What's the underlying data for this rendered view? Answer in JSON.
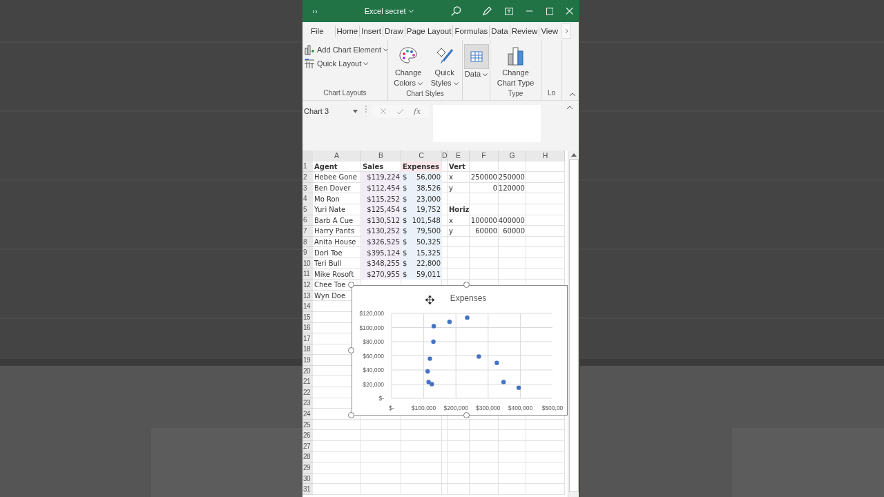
{
  "window": {
    "title": "Excel secret"
  },
  "ribbon": {
    "tabs": [
      {
        "label": "File",
        "selected": false
      },
      {
        "label": "Home",
        "selected": false
      },
      {
        "label": "Insert",
        "selected": false
      },
      {
        "label": "Draw",
        "selected": false
      },
      {
        "label": "Page Layout",
        "selected": false
      },
      {
        "label": "Formulas",
        "selected": false
      },
      {
        "label": "Data",
        "selected": false
      },
      {
        "label": "Review",
        "selected": false
      },
      {
        "label": "View",
        "selected": false
      }
    ],
    "groups": [
      {
        "label": "Chart Layouts",
        "kind": "small",
        "buttons": [
          {
            "label": "Add Chart Element",
            "dropdown": true
          },
          {
            "label": "Quick Layout",
            "dropdown": true
          }
        ]
      },
      {
        "label": "Chart Styles",
        "kind": "large",
        "buttons": [
          {
            "label": "Change Colors",
            "dropdown": true
          },
          {
            "label": "Quick Styles",
            "dropdown": true
          }
        ]
      },
      {
        "kind": "large",
        "buttons": [
          {
            "label": "Data",
            "dropdown": true,
            "highlighted": true
          }
        ]
      },
      {
        "label": "Type",
        "kind": "large",
        "buttons": [
          {
            "label": "Change Chart Type",
            "dropdown": false
          }
        ]
      },
      {
        "label": "Lo",
        "kind": "large"
      }
    ]
  },
  "formula_bar": {
    "name_box": "Chart 3",
    "fx": "fx"
  },
  "sheet": {
    "columns": [
      {
        "label": "A",
        "kind": "text"
      },
      {
        "label": "B",
        "kind": "number"
      },
      {
        "label": "C",
        "kind": "accounting"
      },
      {
        "label": "D"
      },
      {
        "label": "E",
        "kind": "text"
      },
      {
        "label": "F",
        "kind": "number"
      },
      {
        "label": "G",
        "kind": "number"
      },
      {
        "label": "H"
      }
    ],
    "rows": [
      {
        "number": "1",
        "cells": [
          {
            "text": "Agent",
            "bold": true
          },
          {
            "text": "Sales",
            "bold": true,
            "kind": "text"
          },
          {
            "text": "Expenses",
            "bold": true,
            "kind": "text",
            "color": "#fbe6ea"
          },
          "",
          {
            "text": "Vert",
            "bold": true
          }
        ]
      },
      {
        "number": "2",
        "cells": [
          "Hebee Gone",
          {
            "text": "$119,224",
            "color": "#f2ecf7"
          },
          {
            "symbol": "$",
            "text": "56,000",
            "color": "#eaf1f9"
          },
          "",
          "x",
          "250000",
          "250000"
        ]
      },
      {
        "number": "3",
        "cells": [
          "Ben Dover",
          {
            "text": "$112,454",
            "color": "#f2ecf7"
          },
          {
            "symbol": "$",
            "text": "38,526",
            "color": "#eaf1f9"
          },
          "",
          "y",
          "0",
          "120000"
        ]
      },
      {
        "number": "4",
        "cells": [
          "Mo Ron",
          {
            "text": "$115,252",
            "color": "#f2ecf7"
          },
          {
            "symbol": "$",
            "text": "23,000",
            "color": "#eaf1f9"
          }
        ]
      },
      {
        "number": "5",
        "cells": [
          "Yuri Nate",
          {
            "text": "$125,454",
            "color": "#f2ecf7"
          },
          {
            "symbol": "$",
            "text": "19,752",
            "color": "#eaf1f9"
          },
          "",
          {
            "text": "Horiz",
            "bold": true
          }
        ]
      },
      {
        "number": "6",
        "cells": [
          "Barb A Cue",
          {
            "text": "$130,512",
            "color": "#f2ecf7"
          },
          {
            "symbol": "$",
            "text": "101,548",
            "color": "#eaf1f9"
          },
          "",
          "x",
          "100000",
          "400000"
        ]
      },
      {
        "number": "7",
        "cells": [
          "Harry Pants",
          {
            "text": "$130,252",
            "color": "#f2ecf7"
          },
          {
            "symbol": "$",
            "text": "79,500",
            "color": "#eaf1f9"
          },
          "",
          "y",
          "60000",
          "60000"
        ]
      },
      {
        "number": "8",
        "cells": [
          "Anita House",
          {
            "text": "$326,525",
            "color": "#f2ecf7"
          },
          {
            "symbol": "$",
            "text": "50,325",
            "color": "#eaf1f9"
          }
        ]
      },
      {
        "number": "9",
        "cells": [
          "Dori Toe",
          {
            "text": "$395,124",
            "color": "#f2ecf7"
          },
          {
            "symbol": "$",
            "text": "15,325",
            "color": "#eaf1f9"
          }
        ]
      },
      {
        "number": "10",
        "cells": [
          "Teri Bull",
          {
            "text": "$348,255",
            "color": "#f2ecf7"
          },
          {
            "symbol": "$",
            "text": "22,800",
            "color": "#eaf1f9"
          }
        ]
      },
      {
        "number": "11",
        "cells": [
          "Mike Rosoft",
          {
            "text": "$270,955",
            "color": "#f2ecf7"
          },
          {
            "symbol": "$",
            "text": "59,011",
            "color": "#eaf1f9"
          }
        ]
      },
      {
        "number": "12",
        "cells": [
          "Chee Toe"
        ]
      },
      {
        "number": "13",
        "cells": [
          "Wyn Doe"
        ]
      },
      {
        "number": "14",
        "cells": []
      },
      {
        "number": "15",
        "cells": []
      },
      {
        "number": "16",
        "cells": []
      },
      {
        "number": "17",
        "cells": []
      },
      {
        "number": "18",
        "cells": []
      },
      {
        "number": "19",
        "cells": []
      },
      {
        "number": "20",
        "cells": []
      },
      {
        "number": "21",
        "cells": []
      },
      {
        "number": "22",
        "cells": []
      },
      {
        "number": "23",
        "cells": []
      },
      {
        "number": "24",
        "cells": []
      },
      {
        "number": "25",
        "cells": []
      },
      {
        "number": "26",
        "cells": []
      },
      {
        "number": "27",
        "cells": []
      },
      {
        "number": "28",
        "cells": []
      },
      {
        "number": "29",
        "cells": []
      },
      {
        "number": "30",
        "cells": []
      },
      {
        "number": "31",
        "cells": []
      }
    ]
  },
  "chart": {
    "chart_data": {
      "type": "scatter",
      "title": "Expenses",
      "grid": true,
      "x": [
        119000,
        112000,
        115000,
        125000,
        131000,
        130000,
        327000,
        395000,
        348000,
        271000,
        180000,
        235000
      ],
      "series": [
        {
          "color": "#4472c4",
          "values": [
            56000,
            38000,
            23000,
            20000,
            102000,
            80000,
            50000,
            15000,
            23000,
            59000,
            108000,
            114000
          ]
        }
      ],
      "xlim": [
        0,
        500000
      ],
      "ylim": [
        0,
        120000
      ],
      "xticks": [
        {
          "value": 0,
          "label": "$-"
        },
        {
          "value": 100000,
          "label": "$100,000"
        },
        {
          "value": 200000,
          "label": "$200,000"
        },
        {
          "value": 300000,
          "label": "$300,000"
        },
        {
          "value": 400000,
          "label": "$400,000"
        }
      ],
      "annotations": [
        "$500,00"
      ],
      "yticks": [
        {
          "value": 0,
          "label": "$-"
        },
        {
          "value": 20000,
          "label": "$20,000"
        },
        {
          "value": 40000,
          "label": "$40,000"
        },
        {
          "value": 60000,
          "label": "$60,000"
        },
        {
          "value": 80000,
          "label": "$80,000"
        },
        {
          "value": 100000,
          "label": "$100,000"
        },
        {
          "value": 120000,
          "label": "$120,000"
        }
      ]
    }
  }
}
